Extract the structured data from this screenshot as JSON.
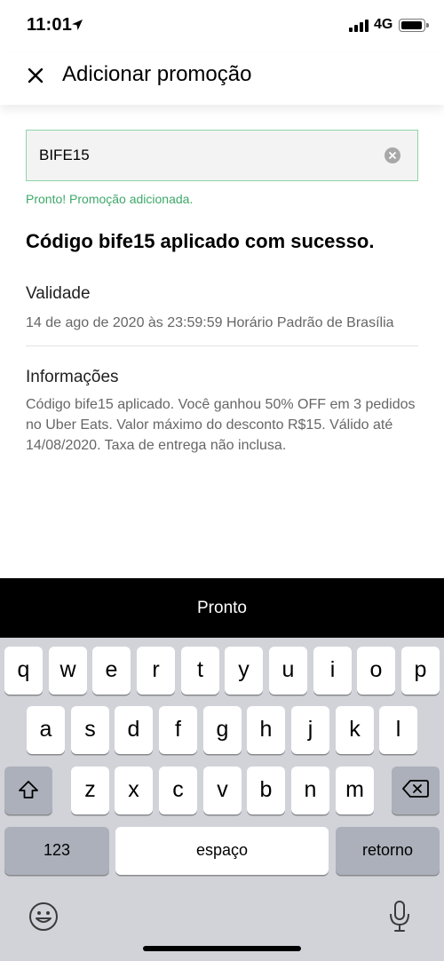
{
  "status_bar": {
    "time": "11:01",
    "network": "4G"
  },
  "header": {
    "title": "Adicionar promoção"
  },
  "promo": {
    "code_value": "BIFE15",
    "success_message": "Pronto! Promoção adicionada.",
    "applied_title": "Código bife15 aplicado com sucesso."
  },
  "validity": {
    "label": "Validade",
    "text": "14 de ago de 2020 às 23:59:59 Horário Padrão de Brasília"
  },
  "info": {
    "label": "Informações",
    "text": "Código bife15 aplicado. Você ganhou 50% OFF em 3 pedidos no Uber Eats. Valor máximo do desconto R$15. Válido até 14/08/2020. Taxa de entrega não inclusa."
  },
  "done_bar": {
    "label": "Pronto"
  },
  "keyboard": {
    "row1": [
      "q",
      "w",
      "e",
      "r",
      "t",
      "y",
      "u",
      "i",
      "o",
      "p"
    ],
    "row2": [
      "a",
      "s",
      "d",
      "f",
      "g",
      "h",
      "j",
      "k",
      "l"
    ],
    "row3": [
      "z",
      "x",
      "c",
      "v",
      "b",
      "n",
      "m"
    ],
    "numbers_label": "123",
    "space_label": "espaço",
    "return_label": "retorno"
  },
  "colors": {
    "success": "#3ea86a",
    "field_border": "#8fd4a8",
    "keyboard_bg": "#d1d3d9"
  }
}
